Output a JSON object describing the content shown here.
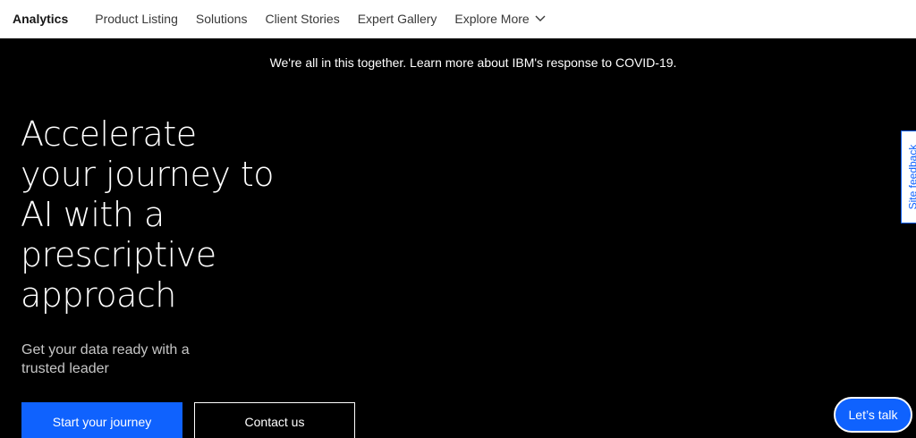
{
  "nav": {
    "brand": "Analytics",
    "items": [
      "Product Listing",
      "Solutions",
      "Client Stories",
      "Expert Gallery",
      "Explore More"
    ]
  },
  "banner": "We're all in this together. Learn more about IBM's response to COVID-19.",
  "hero": {
    "title_lines": [
      "Accelerate",
      "your journey to",
      "AI with a",
      "prescriptive",
      "approach"
    ],
    "subtitle": "Get your data ready with a trusted leader",
    "primary_button": "Start your journey",
    "secondary_button": "Contact us"
  },
  "feedback_tab": "Site feedback",
  "chat_button": "Let’s talk",
  "colors": {
    "accent": "#0f62fe",
    "background": "#000000",
    "nav_bg": "#ffffff"
  },
  "icons": {
    "explore_more": "chevron-down-icon"
  }
}
